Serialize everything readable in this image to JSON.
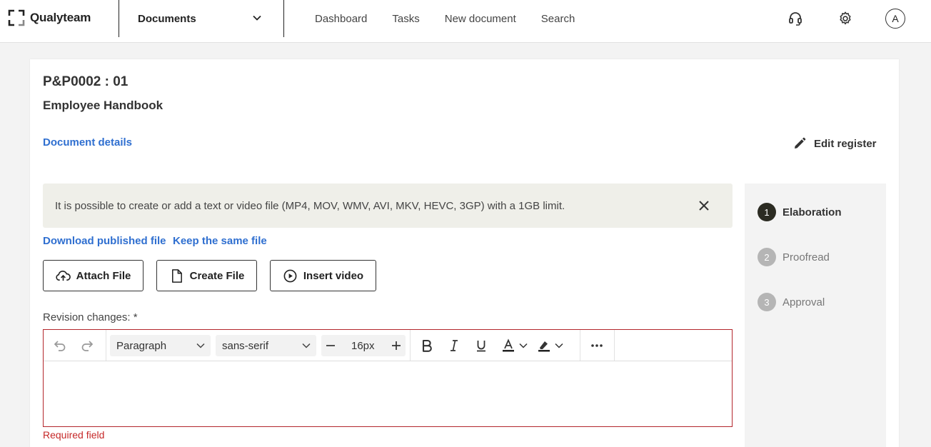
{
  "header": {
    "logo_text": "Qualyteam",
    "module_label": "Documents",
    "nav": [
      "Dashboard",
      "Tasks",
      "New document",
      "Search"
    ],
    "avatar_initial": "A"
  },
  "document": {
    "code": "P&P0002 : 01",
    "title": "Employee Handbook",
    "details_link": "Document details",
    "edit_register": "Edit register"
  },
  "notice": {
    "text": "It is possible to create or add a text or video file (MP4, MOV, WMV, AVI, MKV, HEVC, 3GP) with a 1GB limit."
  },
  "links": {
    "download_published": "Download published file",
    "keep_same": "Keep the same file"
  },
  "buttons": {
    "attach": "Attach File",
    "create": "Create File",
    "insert_video": "Insert video"
  },
  "revision": {
    "label": "Revision changes: *",
    "required": "Required field"
  },
  "editor": {
    "block_format": "Paragraph",
    "font_family": "sans-serif",
    "font_size": "16px"
  },
  "steps": [
    {
      "number": "1",
      "label": "Elaboration",
      "active": true
    },
    {
      "number": "2",
      "label": "Proofread",
      "active": false
    },
    {
      "number": "3",
      "label": "Approval",
      "active": false
    }
  ],
  "colors": {
    "link": "#2f6fd0",
    "error": "#b3262c",
    "step_active": "#2b2b22",
    "step_inactive": "#b5b5b5"
  }
}
